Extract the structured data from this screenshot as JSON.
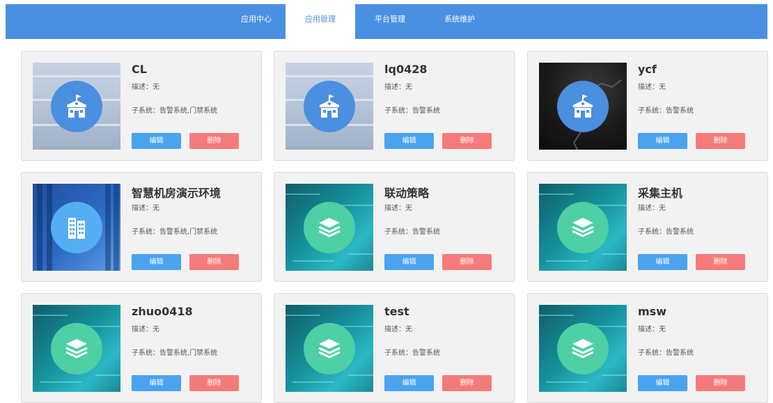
{
  "nav": {
    "tabs": [
      {
        "label": "应用中心",
        "active": false
      },
      {
        "label": "应用管理",
        "active": true
      },
      {
        "label": "平台管理",
        "active": false
      },
      {
        "label": "系统维护",
        "active": false
      }
    ]
  },
  "colors": {
    "nav_bg": "#4a90e2",
    "edit_button": "#4aa3ee",
    "delete_button": "#f57b7b",
    "card_bg": "#f2f2f2"
  },
  "cards": [
    {
      "title": "CL",
      "desc_label": "描述：无",
      "subsystems": "子系统：告警系统,门禁系统",
      "edit": "编辑",
      "delete": "删除",
      "icon": "school-icon",
      "thumbnail": "classroom"
    },
    {
      "title": "lq0428",
      "desc_label": "描述：无",
      "subsystems": "子系统：告警系统",
      "edit": "编辑",
      "delete": "删除",
      "icon": "school-icon",
      "thumbnail": "classroom"
    },
    {
      "title": "ycf",
      "desc_label": "描述：无",
      "subsystems": "子系统：告警系统",
      "edit": "编辑",
      "delete": "删除",
      "icon": "school-icon",
      "thumbnail": "dark"
    },
    {
      "title": "智慧机房演示环境",
      "desc_label": "描述：无",
      "subsystems": "子系统：告警系统,门禁系统",
      "edit": "编辑",
      "delete": "删除",
      "icon": "building-icon",
      "thumbnail": "server-room"
    },
    {
      "title": "联动策略",
      "desc_label": "描述：无",
      "subsystems": "子系统：告警系统",
      "edit": "编辑",
      "delete": "删除",
      "icon": "layers-icon",
      "thumbnail": "circuit"
    },
    {
      "title": "采集主机",
      "desc_label": "描述：无",
      "subsystems": "子系统：告警系统",
      "edit": "编辑",
      "delete": "删除",
      "icon": "layers-icon",
      "thumbnail": "circuit"
    },
    {
      "title": "zhuo0418",
      "desc_label": "描述：无",
      "subsystems": "子系统：告警系统,门禁系统",
      "edit": "编辑",
      "delete": "删除",
      "icon": "layers-icon",
      "thumbnail": "circuit"
    },
    {
      "title": "test",
      "desc_label": "描述：无",
      "subsystems": "子系统：告警系统",
      "edit": "编辑",
      "delete": "删除",
      "icon": "layers-icon",
      "thumbnail": "circuit"
    },
    {
      "title": "msw",
      "desc_label": "描述：无",
      "subsystems": "子系统：告警系统",
      "edit": "编辑",
      "delete": "删除",
      "icon": "layers-icon",
      "thumbnail": "circuit"
    }
  ]
}
